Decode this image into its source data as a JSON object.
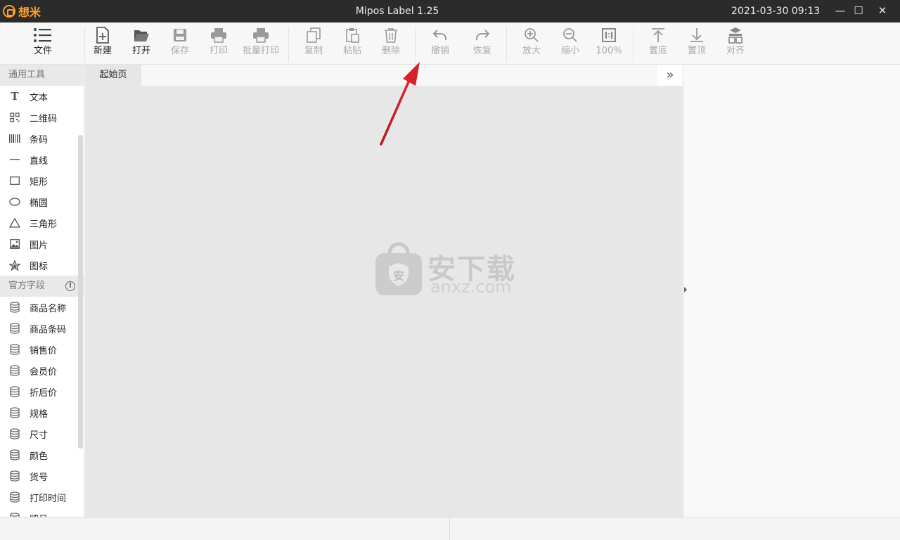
{
  "app": {
    "logo_text": "想米",
    "title": "Mipos Label 1.25",
    "datetime": "2021-03-30 09:13"
  },
  "window_controls": {
    "minimize": "—",
    "maximize": "☐",
    "close": "✕"
  },
  "toolbar": {
    "file": "文件",
    "new": "新建",
    "open": "打开",
    "save": "保存",
    "print": "打印",
    "batch_print": "批量打印",
    "copy": "复制",
    "paste": "粘贴",
    "delete": "删除",
    "undo": "撤销",
    "redo": "恢复",
    "zoom_in": "放大",
    "zoom_out": "缩小",
    "zoom_level": "100%",
    "to_bottom": "置底",
    "to_top": "置顶",
    "align": "对齐"
  },
  "sidebar": {
    "general_tools_title": "通用工具",
    "tools": [
      {
        "label": "文本",
        "icon": "text-icon"
      },
      {
        "label": "二维码",
        "icon": "qrcode-icon"
      },
      {
        "label": "条码",
        "icon": "barcode-icon"
      },
      {
        "label": "直线",
        "icon": "line-icon"
      },
      {
        "label": "矩形",
        "icon": "rectangle-icon"
      },
      {
        "label": "椭圆",
        "icon": "ellipse-icon"
      },
      {
        "label": "三角形",
        "icon": "triangle-icon"
      },
      {
        "label": "图片",
        "icon": "image-icon"
      },
      {
        "label": "图标",
        "icon": "star-icon"
      }
    ],
    "official_fields_title": "官方字段",
    "info_glyph": "!",
    "fields": [
      {
        "label": "商品名称"
      },
      {
        "label": "商品条码"
      },
      {
        "label": "销售价"
      },
      {
        "label": "会员价"
      },
      {
        "label": "折后价"
      },
      {
        "label": "规格"
      },
      {
        "label": "尺寸"
      },
      {
        "label": "颜色"
      },
      {
        "label": "货号"
      },
      {
        "label": "打印时间"
      },
      {
        "label": "牌号"
      }
    ]
  },
  "tabs": {
    "start": "起始页",
    "more": "»"
  },
  "watermark": {
    "cn": "安下载",
    "en": "anxz.com",
    "badge": "安"
  },
  "colors": {
    "logo": "#ff9f2d",
    "titlebar": "#2b2b2b",
    "annotation_arrow": "#d0202a"
  }
}
